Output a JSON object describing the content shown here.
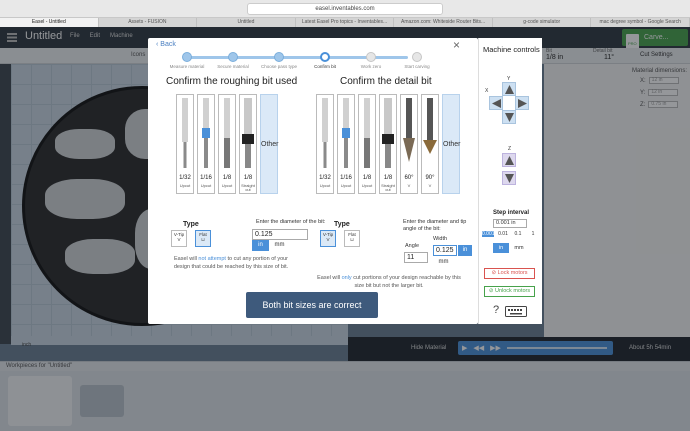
{
  "browser": {
    "url": "easel.inventables.com",
    "tabs": [
      "Easel - Untitled",
      "Assets - FUSION",
      "Untitled",
      "Latest Easel Pro topics - Inventables...",
      "Amazon.com: Whiteside Router Bits...",
      "g-code simulator",
      "mac degree symbol - Google Search"
    ]
  },
  "app": {
    "doc_title": "Untitled",
    "menu": [
      "File",
      "Edit",
      "Machine"
    ],
    "icons_label": "Icons",
    "pro_badge": "PRO",
    "carve_label": "Carve...",
    "bit_label": "Bit",
    "bit_value": "1/8 in",
    "detail_label": "Detail bit",
    "detail_value": "11°",
    "cut_settings": "Cut Settings",
    "material_dimensions": "Material dimensions:",
    "dims": [
      {
        "axis": "X:",
        "value": "12 in"
      },
      {
        "axis": "Y:",
        "value": "12 in"
      },
      {
        "axis": "Z:",
        "value": "0.75 in"
      }
    ],
    "hide_material": "Hide Material",
    "about_time": "About 5h 54min",
    "inch_toggle": "inch",
    "workpieces_label": "Workpieces for \"Untitled\""
  },
  "modal": {
    "back": "Back",
    "steps": [
      {
        "label": "Measure material"
      },
      {
        "label": "Secure material"
      },
      {
        "label": "Choose pass type"
      },
      {
        "label": "Confirm bit"
      },
      {
        "label": "Work zero"
      },
      {
        "label": "Start carving"
      }
    ],
    "current_step": 3,
    "rough": {
      "title": "Confirm the roughing bit used",
      "bits": [
        {
          "size": "1/32",
          "type": "Upcut"
        },
        {
          "size": "1/16",
          "type": "Upcut"
        },
        {
          "size": "1/8",
          "type": "Upcut"
        },
        {
          "size": "1/8",
          "type": "Straight cut"
        }
      ],
      "other": "Other",
      "type_label": "Type",
      "type_options": [
        "V-Tip",
        "Flat"
      ],
      "diameter_caption": "Enter the diameter of the bit:",
      "diameter_value": "0.125",
      "units": [
        "in",
        "mm"
      ],
      "note_pre": "Easel will ",
      "note_hl": "not attempt",
      "note_post": " to cut any portion of your design that could be reached by this size of bit."
    },
    "detail": {
      "title": "Confirm the detail bit",
      "bits": [
        {
          "size": "1/32",
          "type": "Upcut"
        },
        {
          "size": "1/16",
          "type": "Upcut"
        },
        {
          "size": "1/8",
          "type": "Upcut"
        },
        {
          "size": "1/8",
          "type": "Straight cut"
        },
        {
          "size": "60°",
          "type": "V"
        },
        {
          "size": "90°",
          "type": "V"
        }
      ],
      "other": "Other",
      "type_label": "Type",
      "type_options": [
        "V-Tip",
        "Flat"
      ],
      "diameter_caption": "Enter the diameter and tip angle of the bit:",
      "angle_label": "Angle",
      "angle_value": "11",
      "width_label": "Width",
      "width_value": "0.125",
      "units": [
        "in",
        "mm"
      ],
      "note_pre": "Easel will ",
      "note_hl": "only",
      "note_post": " cut portions of your design reachable by this size bit but not the larger bit."
    },
    "confirm": "Both bit sizes are correct"
  },
  "machine": {
    "title": "Machine controls",
    "axis_y": "Y",
    "axis_x": "X",
    "axis_z": "Z",
    "step_title": "Step interval",
    "step_value": "0.001 in",
    "step_options": [
      "0.001",
      "0.01",
      "0.1",
      "1"
    ],
    "units": [
      "in",
      "mm"
    ],
    "lock": "Lock motors",
    "unlock": "Unlock motors",
    "help": "?"
  }
}
